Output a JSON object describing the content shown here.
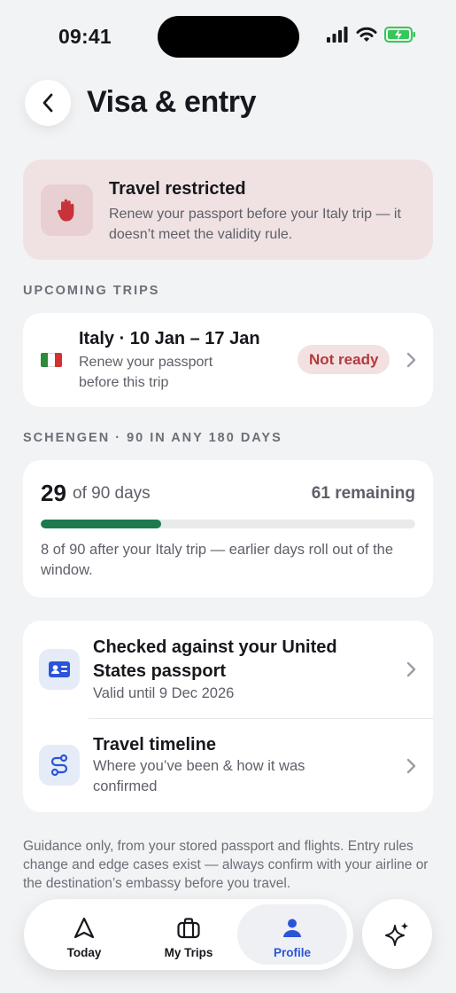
{
  "status_bar": {
    "time": "09:41"
  },
  "header": {
    "title": "Visa & entry"
  },
  "alert": {
    "title": "Travel restricted",
    "body": "Renew your passport before your Italy trip — it doesn’t meet the validity rule.",
    "color": "#f0e2e3"
  },
  "upcoming": {
    "section_label": "UPCOMING TRIPS",
    "trip": {
      "title": "Italy · 10 Jan – 17 Jan",
      "subtitle": "Renew your passport before this trip",
      "badge": "Not ready",
      "flag": [
        "#2e8b3a",
        "#ffffff",
        "#d62f2f"
      ]
    }
  },
  "schengen": {
    "section_label": "SCHENGEN · 90 IN ANY 180 DAYS",
    "used": "29",
    "of_label": "of 90 days",
    "remaining": "61 remaining",
    "progress_fraction": 0.322,
    "note": "8 of 90 after your Italy trip — earlier days roll out of the window."
  },
  "links": [
    {
      "title": "Checked against your United States passport",
      "subtitle": "Valid until 9 Dec 2026",
      "icon": "id-card-icon"
    },
    {
      "title": "Travel timeline",
      "subtitle": "Where you’ve been & how it was confirmed",
      "icon": "route-icon"
    }
  ],
  "disclaimer": "Guidance only, from your stored passport and flights. Entry rules change and edge cases exist — always confirm with your airline or the destination’s embassy before you travel.",
  "tabbar": {
    "tabs": [
      {
        "label": "Today",
        "icon": "navigation-arrow-icon"
      },
      {
        "label": "My Trips",
        "icon": "suitcase-icon"
      },
      {
        "label": "Profile",
        "icon": "person-icon",
        "active": true
      }
    ],
    "fab_icon": "sparkle-icon",
    "accent": "#2a55d8"
  }
}
